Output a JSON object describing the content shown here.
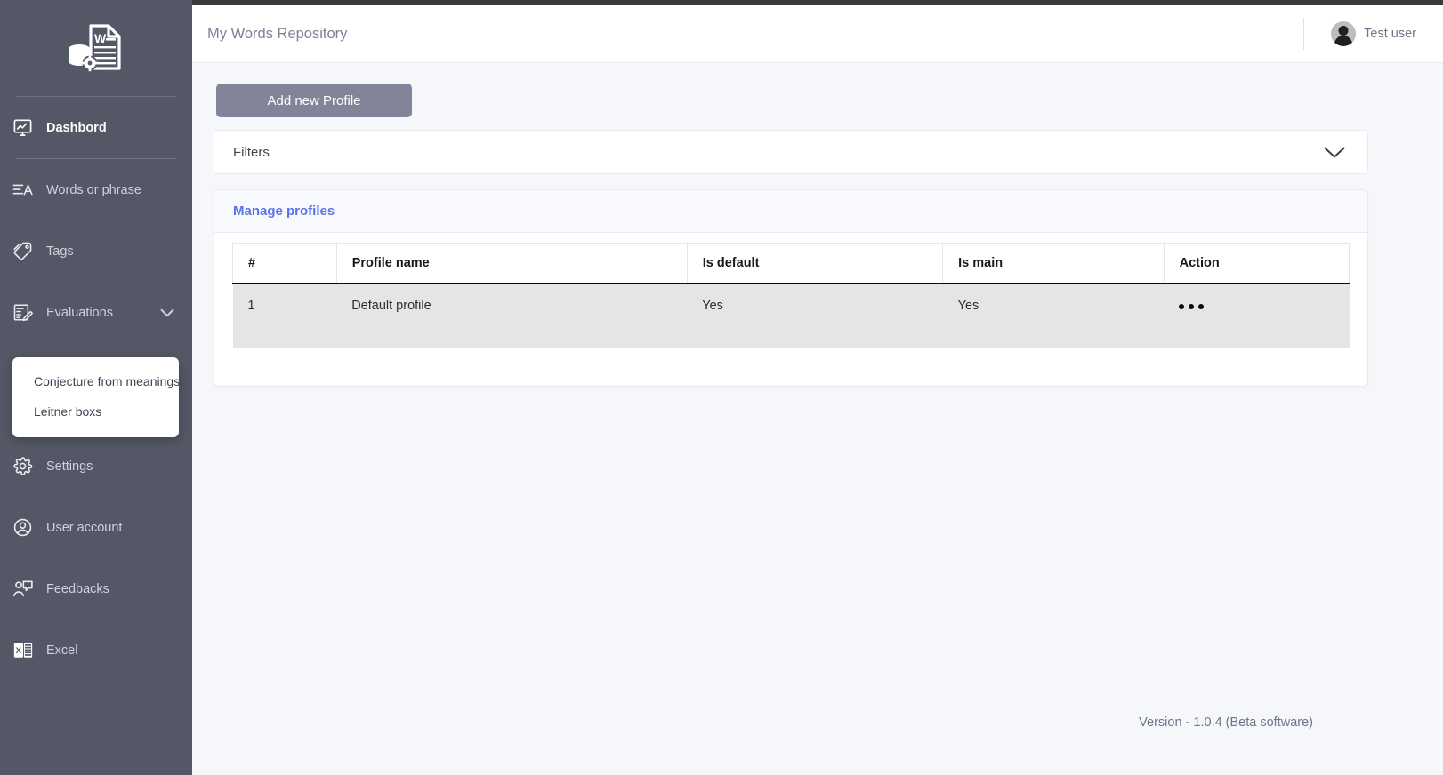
{
  "app": {
    "logo_icon": "word-document-database-icon"
  },
  "sidebar": {
    "items": [
      {
        "label": "Dashbord",
        "icon": "monitor-chart-icon",
        "active": true,
        "expandable": false
      },
      {
        "label": "Words or phrase",
        "icon": "text-lines-a-icon",
        "active": false,
        "expandable": false
      },
      {
        "label": "Tags",
        "icon": "tag-icon",
        "active": false,
        "expandable": false
      },
      {
        "label": "Evaluations",
        "icon": "exam-paper-icon",
        "active": false,
        "expandable": true,
        "chevron": "chevron-down-icon"
      },
      {
        "label": "Settings",
        "icon": "gear-icon",
        "active": false,
        "expandable": false
      },
      {
        "label": "User account",
        "icon": "user-circle-icon",
        "active": false,
        "expandable": false
      },
      {
        "label": "Feedbacks",
        "icon": "user-comment-icon",
        "active": false,
        "expandable": false
      },
      {
        "label": "Excel",
        "icon": "excel-file-icon",
        "active": false,
        "expandable": false
      }
    ],
    "submenu": {
      "parent": "Evaluations",
      "items": [
        {
          "label": "Conjecture from meanings"
        },
        {
          "label": "Leitner boxs"
        }
      ]
    }
  },
  "header": {
    "title": "My Words Repository",
    "user_name": "Test user",
    "avatar_icon": "user-avatar-icon"
  },
  "main": {
    "add_button_label": "Add new Profile",
    "filters": {
      "label": "Filters",
      "chevron_icon": "chevron-down-icon",
      "expanded": false
    },
    "panel": {
      "title": "Manage profiles",
      "table": {
        "columns": [
          "#",
          "Profile name",
          "Is default",
          "Is main",
          "Action"
        ],
        "rows": [
          {
            "index": "1",
            "profile_name": "Default profile",
            "is_default": "Yes",
            "is_main": "Yes",
            "action_icon": "ellipsis-horizontal-icon"
          }
        ]
      }
    },
    "version": "Version - 1.0.4 (Beta software)"
  },
  "colors": {
    "sidebar_bg": "#545765",
    "accent_link": "#5b72f0",
    "button_bg": "#82859a",
    "page_bg": "#f6f7fb",
    "row_bg": "#e5e5e5"
  }
}
